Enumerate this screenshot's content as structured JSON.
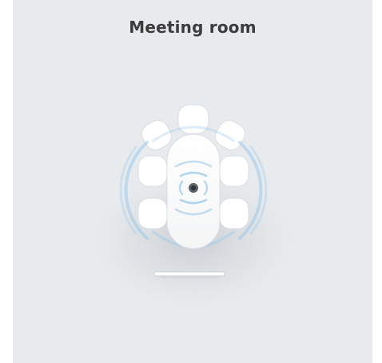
{
  "card": {
    "title": "Meeting room"
  },
  "illustration": {
    "table_icon": "meeting-table-icon",
    "device_icon": "conference-speaker-icon",
    "wave_icon": "audio-wave-icon",
    "tv_icon": "display-screen-icon",
    "chair_count": 7
  },
  "colors": {
    "background": "#e8ebee",
    "title": "#3c3c3c",
    "wave": "#9cc9ea",
    "surface": "#ffffff",
    "outline": "#d9dde1"
  }
}
